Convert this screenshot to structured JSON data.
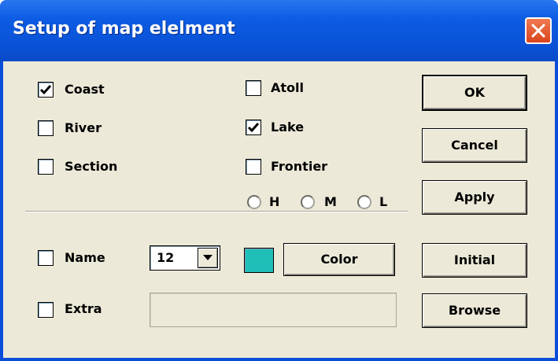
{
  "window": {
    "title": "Setup of map elelment",
    "accent": "#0a4ddb"
  },
  "checkboxes": {
    "coast": {
      "label": "Coast",
      "checked": true
    },
    "river": {
      "label": "River",
      "checked": false
    },
    "section": {
      "label": "Section",
      "checked": false
    },
    "atoll": {
      "label": "Atoll",
      "checked": false
    },
    "lake": {
      "label": "Lake",
      "checked": true
    },
    "frontier": {
      "label": "Frontier",
      "checked": false
    },
    "name": {
      "label": "Name",
      "checked": false
    },
    "extra": {
      "label": "Extra",
      "checked": false
    }
  },
  "resolution": {
    "options": [
      "H",
      "M",
      "L"
    ],
    "selected": null
  },
  "font_size": {
    "value": "12"
  },
  "color": {
    "swatch": "#1fbfb8",
    "button_label": "Color"
  },
  "extra_field": {
    "value": ""
  },
  "buttons": {
    "ok": "OK",
    "cancel": "Cancel",
    "apply": "Apply",
    "initial": "Initial",
    "browse": "Browse"
  }
}
